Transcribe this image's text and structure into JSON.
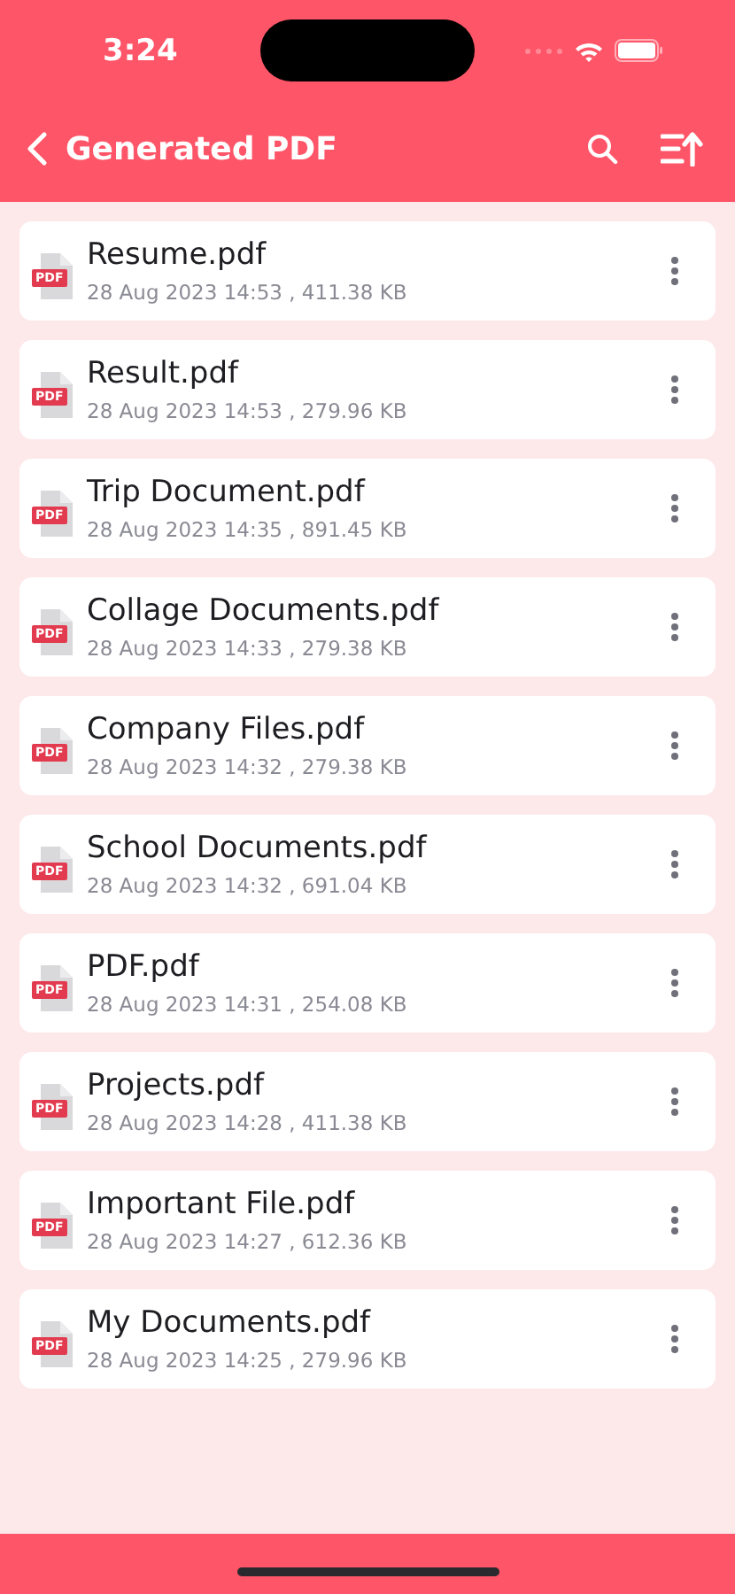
{
  "status_bar": {
    "time": "3:24"
  },
  "header": {
    "title": "Generated PDF"
  },
  "files": [
    {
      "name": "Resume.pdf",
      "details": "28 Aug 2023 14:53 , 411.38 KB",
      "icon_label": "PDF"
    },
    {
      "name": "Result.pdf",
      "details": "28 Aug 2023 14:53 , 279.96 KB",
      "icon_label": "PDF"
    },
    {
      "name": "Trip Document.pdf",
      "details": "28 Aug 2023 14:35 , 891.45 KB",
      "icon_label": "PDF"
    },
    {
      "name": "Collage Documents.pdf",
      "details": "28 Aug 2023 14:33 , 279.38 KB",
      "icon_label": "PDF"
    },
    {
      "name": "Company Files.pdf",
      "details": "28 Aug 2023 14:32 , 279.38 KB",
      "icon_label": "PDF"
    },
    {
      "name": "School Documents.pdf",
      "details": "28 Aug 2023 14:32 , 691.04 KB",
      "icon_label": "PDF"
    },
    {
      "name": "PDF.pdf",
      "details": "28 Aug 2023 14:31 , 254.08 KB",
      "icon_label": "PDF"
    },
    {
      "name": "Projects.pdf",
      "details": "28 Aug 2023 14:28 , 411.38 KB",
      "icon_label": "PDF"
    },
    {
      "name": "Important File.pdf",
      "details": "28 Aug 2023 14:27 , 612.36 KB",
      "icon_label": "PDF"
    },
    {
      "name": "My Documents.pdf",
      "details": "28 Aug 2023 14:25 , 279.96 KB",
      "icon_label": "PDF"
    }
  ]
}
